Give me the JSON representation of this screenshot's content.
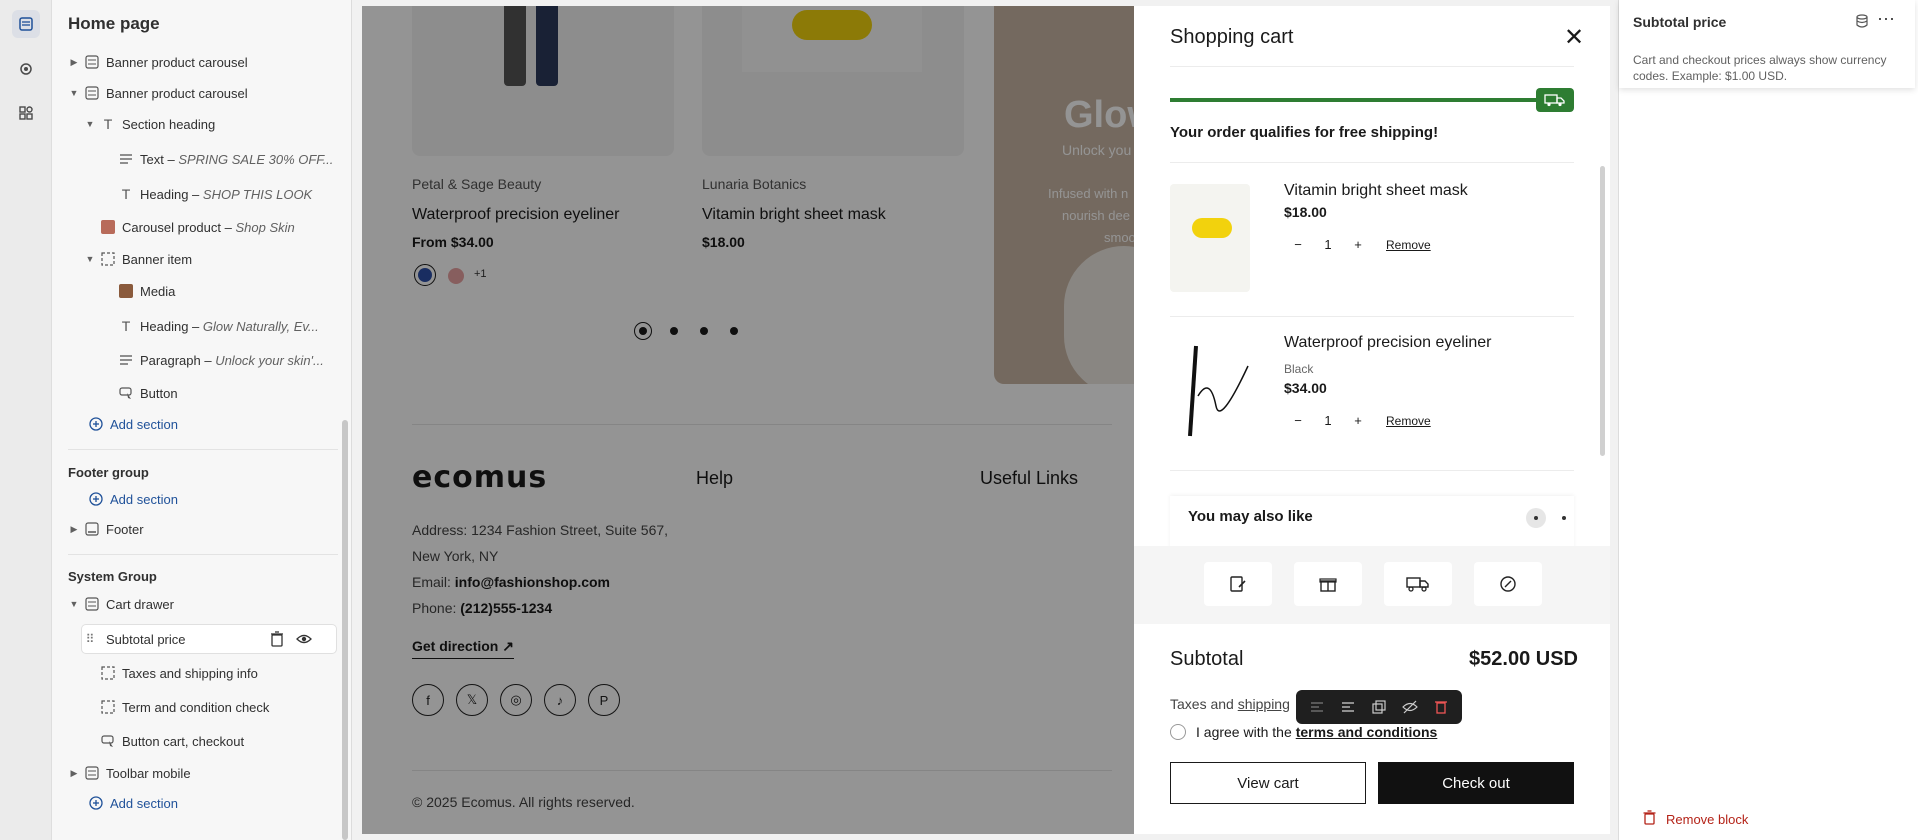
{
  "sidebar": {
    "title": "Home page",
    "tree": {
      "banner1": "Banner product carousel",
      "banner2": "Banner product carousel",
      "section_heading": "Section heading",
      "text_label": "Text",
      "text_value": "SPRING SALE 30% OFF...",
      "heading_label": "Heading",
      "heading_value": "SHOP THIS LOOK",
      "carousel_label": "Carousel product",
      "carousel_value": "Shop Skin",
      "banner_item": "Banner item",
      "media": "Media",
      "heading2_label": "Heading",
      "heading2_value": "Glow Naturally, Ev...",
      "paragraph_label": "Paragraph",
      "paragraph_value": "Unlock your skin'...",
      "button": "Button",
      "add_section": "Add section"
    },
    "footer_group": {
      "title": "Footer group",
      "add_section": "Add section",
      "footer": "Footer"
    },
    "system_group": {
      "title": "System Group",
      "cart_drawer": "Cart drawer",
      "subtotal_price": "Subtotal price",
      "taxes": "Taxes and shipping info",
      "terms": "Term and condition check",
      "button_cart": "Button cart, checkout",
      "toolbar_mobile": "Toolbar mobile",
      "add_section": "Add section"
    }
  },
  "preview": {
    "products": [
      {
        "brand": "Petal & Sage Beauty",
        "name": "Waterproof precision eyeliner",
        "price": "From $34.00",
        "more": "+1"
      },
      {
        "brand": "Lunaria Botanics",
        "name": "Vitamin bright sheet mask",
        "price": "$18.00"
      }
    ],
    "banner": {
      "heading": "Glow",
      "sub1": "Unlock you",
      "sub2": "Infused with n",
      "sub3": "nourish dee",
      "sub4": "smoo"
    },
    "footer": {
      "logo": "ecomus",
      "help": "Help",
      "useful_links": "Useful Links",
      "address1": "Address: 1234 Fashion Street, Suite 567,",
      "address2": "New York, NY",
      "email_label": "Email:",
      "email": "info@fashionshop.com",
      "phone_label": "Phone:",
      "phone": "(212)555-1234",
      "direction": "Get direction",
      "copyright": "© 2025 Ecomus. All rights reserved."
    }
  },
  "cart": {
    "title": "Shopping cart",
    "qualifies": "Your order qualifies for free shipping!",
    "items": [
      {
        "name": "Vitamin bright sheet mask",
        "price": "$18.00",
        "qty": "1",
        "remove": "Remove"
      },
      {
        "name": "Waterproof precision eyeliner",
        "variant": "Black",
        "price": "$34.00",
        "qty": "1",
        "remove": "Remove"
      }
    ],
    "also_like": "You may also like",
    "subtotal_label": "Subtotal",
    "subtotal_value": "$52.00 USD",
    "taxes": "Taxes and",
    "shipping": "shipping",
    "agree_prefix": "I agree with the",
    "agree_link": "terms and conditions",
    "view_cart": "View cart",
    "checkout": "Check out",
    "free_shipping_progress": 1.0
  },
  "inspector": {
    "title": "Subtotal price",
    "description": "Cart and checkout prices always show currency codes. Example: $1.00 USD.",
    "remove_block": "Remove block"
  },
  "colors": {
    "accent_green": "#2e7d32",
    "danger": "#b42318",
    "link_blue": "#1f5199"
  }
}
